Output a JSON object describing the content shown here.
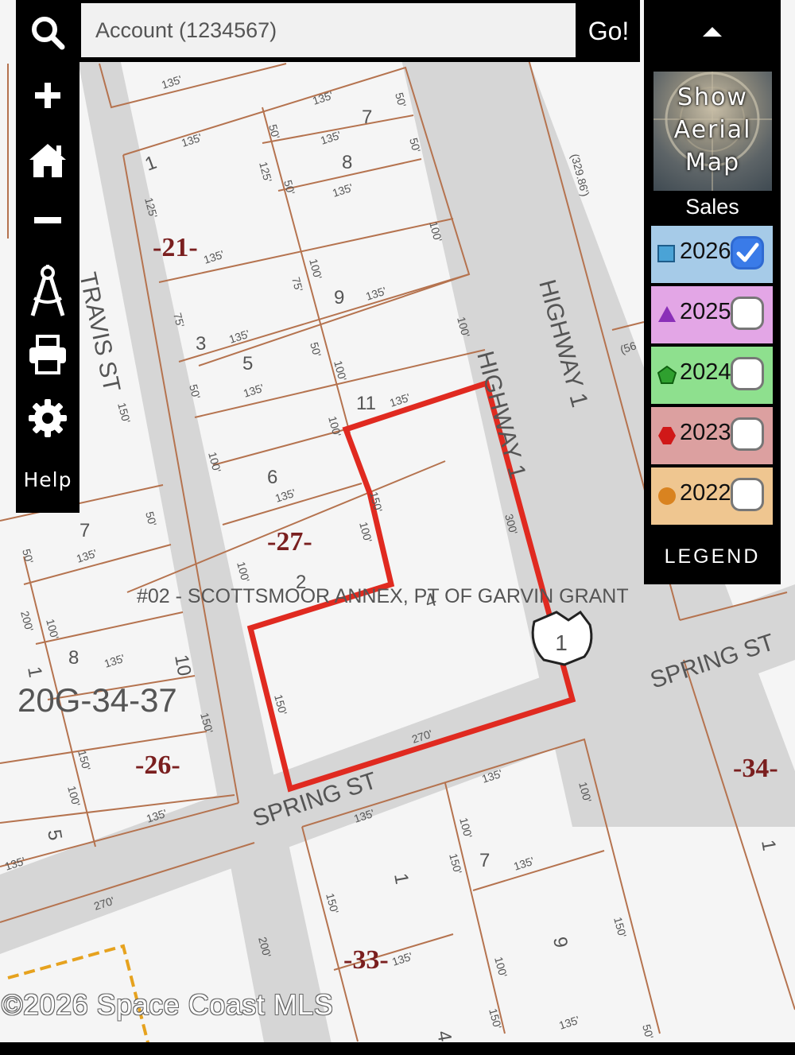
{
  "search": {
    "placeholder": "Account (1234567)",
    "go_label": "Go!"
  },
  "toolbar": {
    "help_label": "Help"
  },
  "panel": {
    "aerial_label": "Show Aerial Map",
    "sales_label": "Sales",
    "legend_label": "LEGEND",
    "years": [
      {
        "year": "2026",
        "checked": true,
        "color": "#a6cbe8",
        "symbol": "square"
      },
      {
        "year": "2025",
        "checked": false,
        "color": "#e3a6e6",
        "symbol": "triangle"
      },
      {
        "year": "2024",
        "checked": false,
        "color": "#8ee08e",
        "symbol": "pentagon"
      },
      {
        "year": "2023",
        "checked": false,
        "color": "#dca0a0",
        "symbol": "hexagon"
      },
      {
        "year": "2022",
        "checked": false,
        "color": "#efc690",
        "symbol": "circle"
      }
    ]
  },
  "map": {
    "streets": {
      "travis": "TRAVIS ST",
      "highway_1": "HIGHWAY 1",
      "highway_1_b": "HIGHWAY 1",
      "spring_1": "SPRING ST",
      "spring_2": "SPRING ST"
    },
    "subdivision_label": "#02 - SCOTTSMOOR ANNEX, PT OF GARVIN GRANT",
    "map_id": "20G-34-37",
    "blocks": {
      "b21": "-21-",
      "b27": "-27-",
      "b26": "-26-",
      "b33": "-33-",
      "b34": "-34-"
    },
    "lots": {
      "l1": "1",
      "l3": "3",
      "l5": "5",
      "l6": "6",
      "l7a": "7",
      "l8a": "8",
      "l9a": "9",
      "l11": "11",
      "l2": "2",
      "l4": "4",
      "l7b": "7",
      "l8b": "8",
      "l10": "10",
      "l1b": "1",
      "l5b": "5",
      "l1c": "1",
      "l7c": "7",
      "l9b": "9",
      "l1d": "1",
      "l4b": "4"
    },
    "dims": {
      "d135": "135'",
      "d50": "50'",
      "d75": "75'",
      "d100": "100'",
      "d125": "125'",
      "d150": "150'",
      "d200": "200'",
      "d270": "270'",
      "d300": "300'",
      "d329": "(329.86')",
      "d56": "(56"
    },
    "shield": "1"
  },
  "copyright": "©2026 Space Coast MLS"
}
